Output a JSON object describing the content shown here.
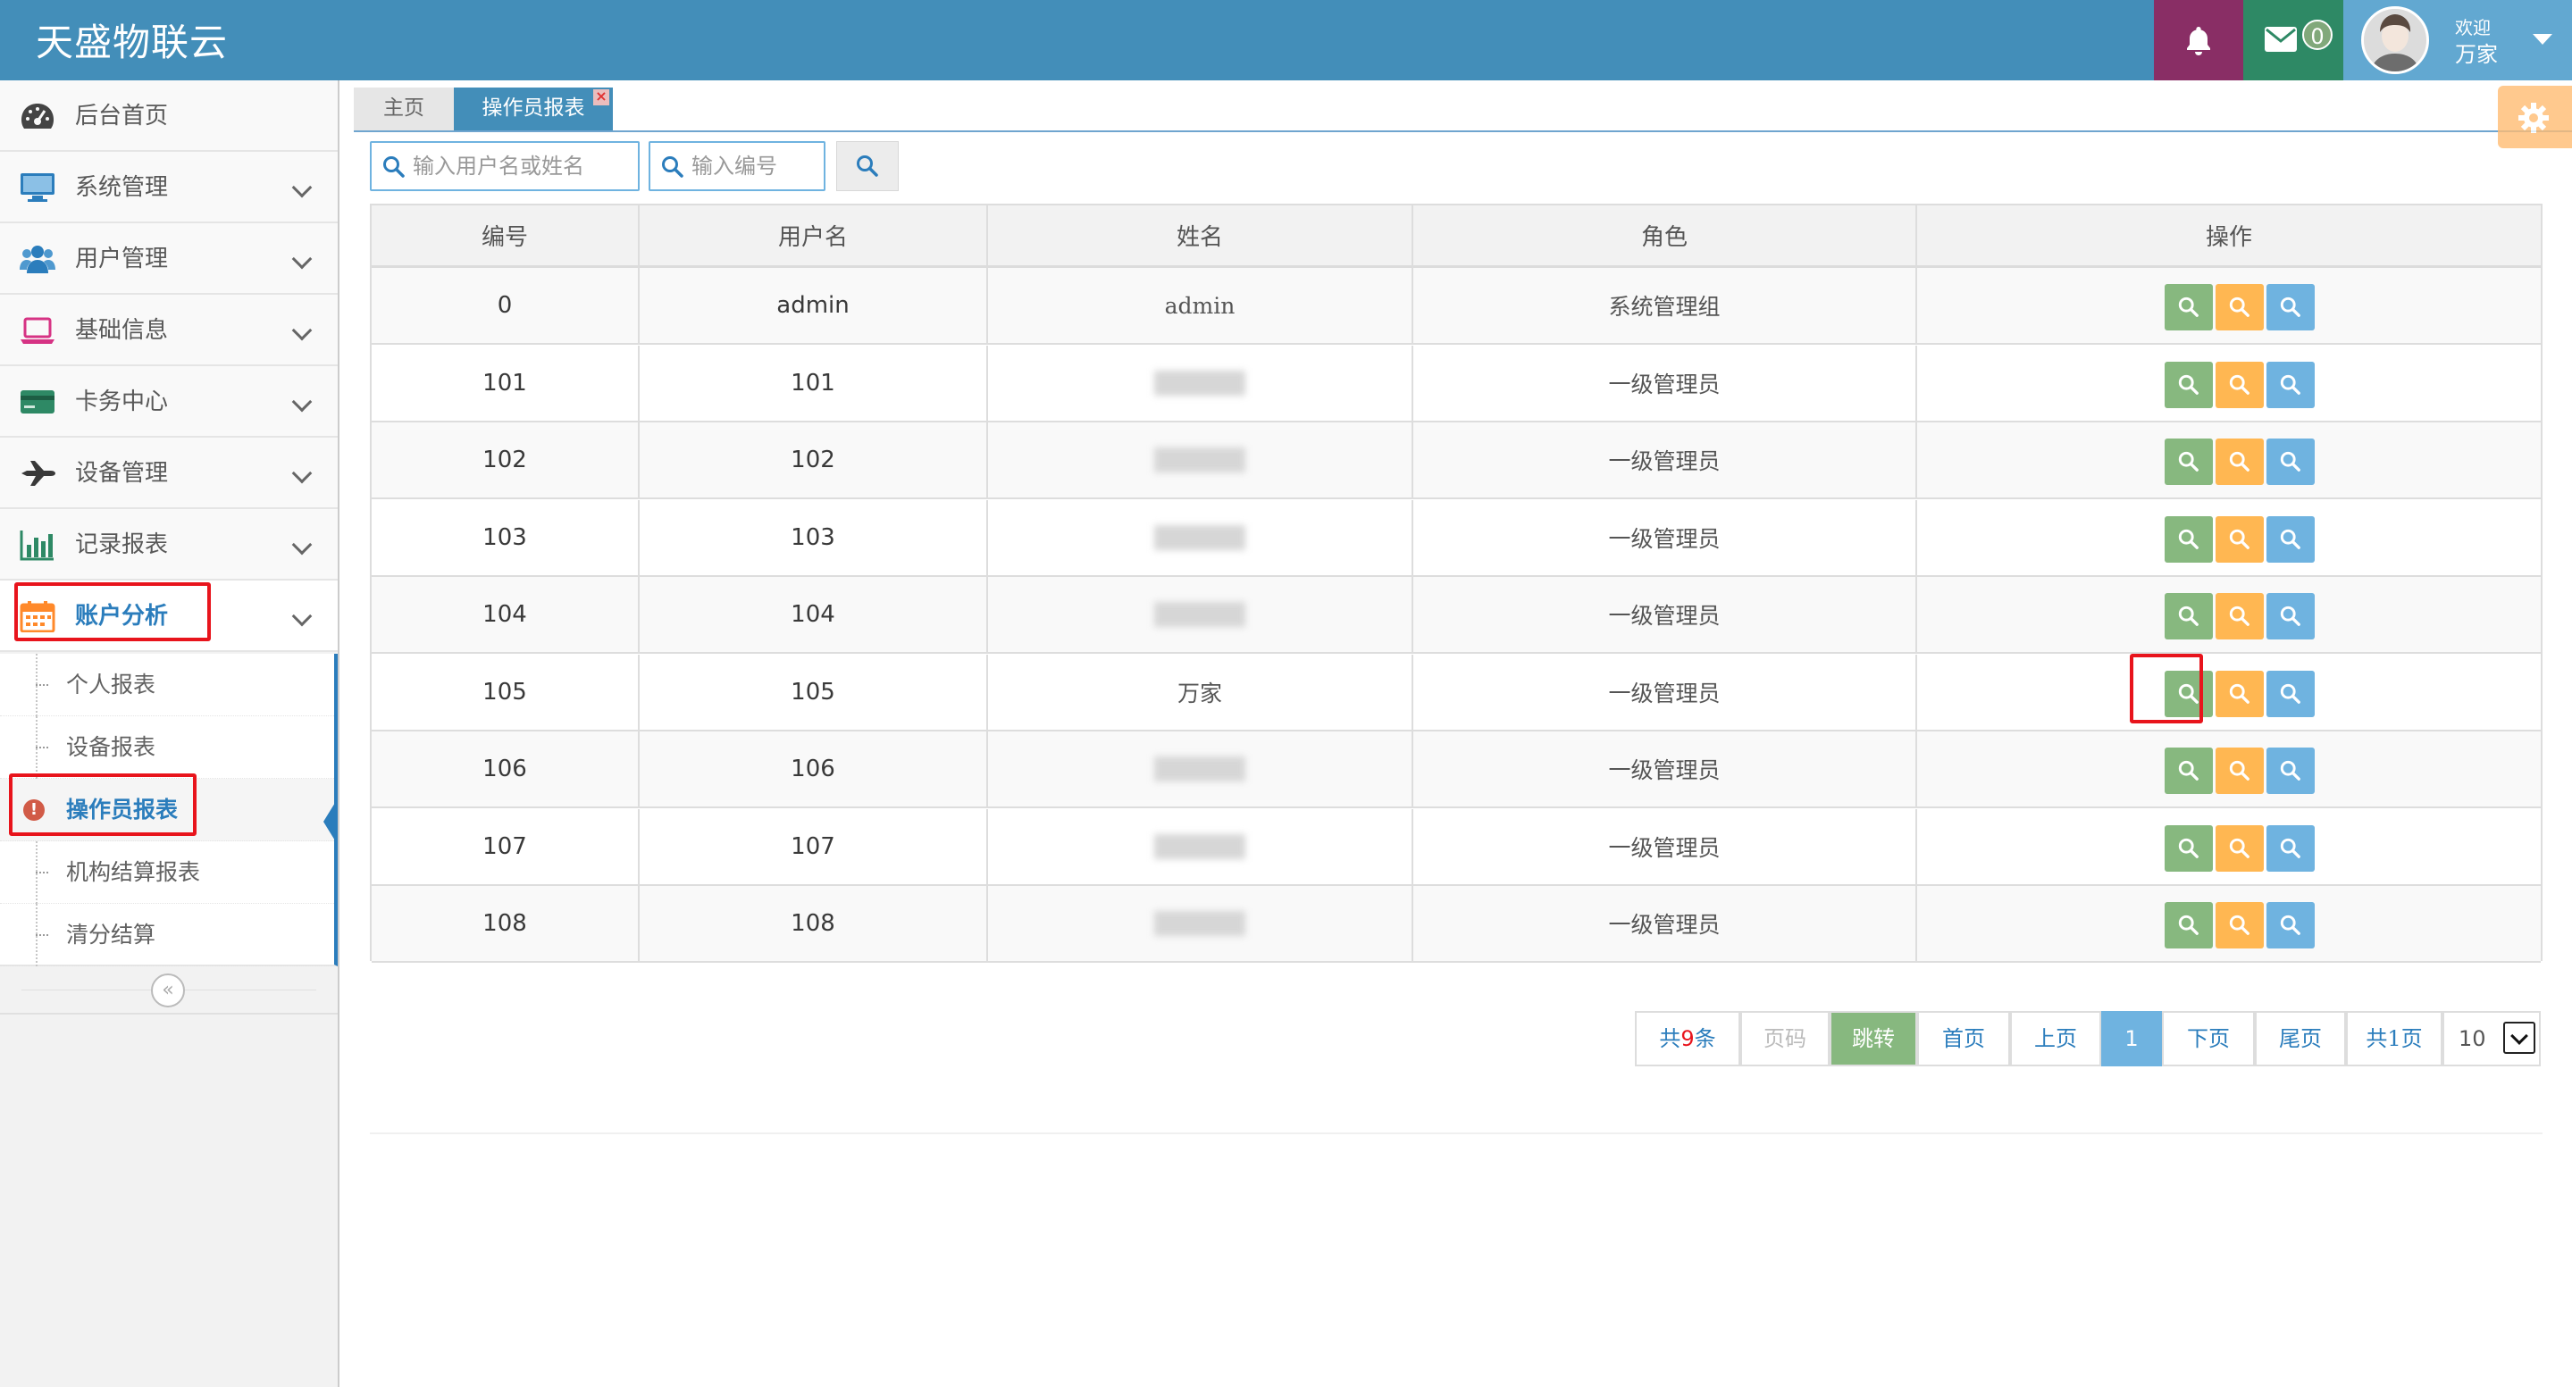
{
  "app": {
    "brand": "天盛物联云"
  },
  "navbar": {
    "mail_count": "0",
    "welcome": "欢迎",
    "user_name": "万家",
    "colors": {
      "bar": "#438eb9",
      "bell": "#892e65",
      "mail": "#2e8965",
      "user": "#62a8d1"
    }
  },
  "sidebar": {
    "items": [
      {
        "label": "后台首页",
        "icon": "dashboard-icon",
        "color": "#333333"
      },
      {
        "label": "系统管理",
        "icon": "desktop-icon",
        "color": "#2b7dbc"
      },
      {
        "label": "用户管理",
        "icon": "users-icon",
        "color": "#2b7dbc"
      },
      {
        "label": "基础信息",
        "icon": "laptop-icon",
        "color": "#d63384"
      },
      {
        "label": "卡务中心",
        "icon": "credit-card-icon",
        "color": "#2e8965"
      },
      {
        "label": "设备管理",
        "icon": "plane-icon",
        "color": "#333333"
      },
      {
        "label": "记录报表",
        "icon": "bar-chart-icon",
        "color": "#2e8965"
      },
      {
        "label": "账户分析",
        "icon": "calendar-icon",
        "color": "#ff892a"
      }
    ],
    "submenu": [
      {
        "label": "个人报表"
      },
      {
        "label": "设备报表"
      },
      {
        "label": "操作员报表"
      },
      {
        "label": "机构结算报表"
      },
      {
        "label": "清分结算"
      }
    ]
  },
  "tabs": {
    "home": "主页",
    "active": "操作员报表",
    "close": "×"
  },
  "search": {
    "user_placeholder": "输入用户名或姓名",
    "id_placeholder": "输入编号"
  },
  "table": {
    "headers": [
      "编号",
      "用户名",
      "姓名",
      "角色",
      "操作"
    ],
    "rows": [
      {
        "id": "0",
        "username": "admin",
        "name": "admin",
        "role": "系统管理组",
        "name_visible": true
      },
      {
        "id": "101",
        "username": "101",
        "name": "",
        "role": "一级管理员",
        "name_visible": false
      },
      {
        "id": "102",
        "username": "102",
        "name": "",
        "role": "一级管理员",
        "name_visible": false
      },
      {
        "id": "103",
        "username": "103",
        "name": "",
        "role": "一级管理员",
        "name_visible": false
      },
      {
        "id": "104",
        "username": "104",
        "name": "",
        "role": "一级管理员",
        "name_visible": false
      },
      {
        "id": "105",
        "username": "105",
        "name": "万家",
        "role": "一级管理员",
        "name_visible": true
      },
      {
        "id": "106",
        "username": "106",
        "name": "",
        "role": "一级管理员",
        "name_visible": false
      },
      {
        "id": "107",
        "username": "107",
        "name": "",
        "role": "一级管理员",
        "name_visible": false
      },
      {
        "id": "108",
        "username": "108",
        "name": "",
        "role": "一级管理员",
        "name_visible": false
      }
    ],
    "action_colors": [
      "#87b87f",
      "#ffb752",
      "#6fb3e0"
    ]
  },
  "pagination": {
    "total_prefix": "共",
    "total_count": "9",
    "total_suffix": "条",
    "page_input_placeholder": "页码",
    "jump": "跳转",
    "first": "首页",
    "prev": "上页",
    "current": "1",
    "next": "下页",
    "last": "尾页",
    "page_count": "共1页",
    "page_size": "10"
  }
}
